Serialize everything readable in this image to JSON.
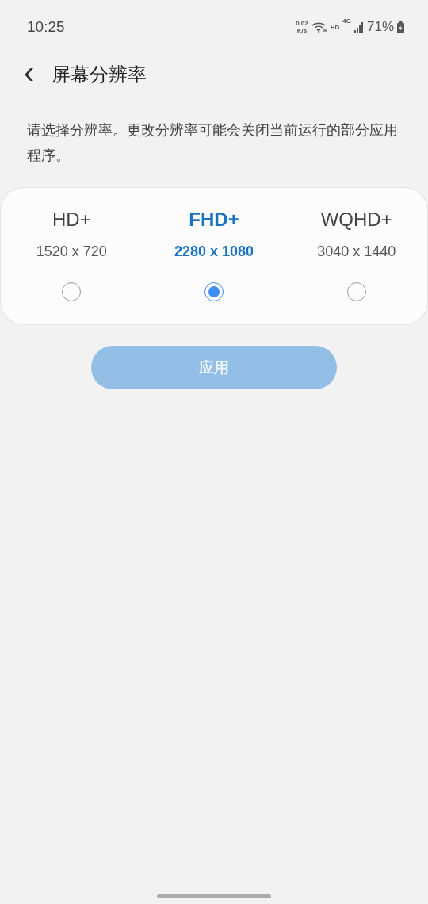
{
  "status_bar": {
    "time": "10:25",
    "speed_value": "0.02",
    "speed_unit": "K/s",
    "hd_label": "HD",
    "network": "4G",
    "battery": "71%"
  },
  "header": {
    "back": "‹",
    "title": "屏幕分辨率"
  },
  "description": "请选择分辨率。更改分辨率可能会关闭当前运行的部分应用程序。",
  "options": [
    {
      "label": "HD+",
      "resolution": "1520 x 720",
      "selected": false
    },
    {
      "label": "FHD+",
      "resolution": "2280 x 1080",
      "selected": true
    },
    {
      "label": "WQHD+",
      "resolution": "3040 x 1440",
      "selected": false
    }
  ],
  "apply_button": {
    "label": "应用",
    "disabled": true
  }
}
